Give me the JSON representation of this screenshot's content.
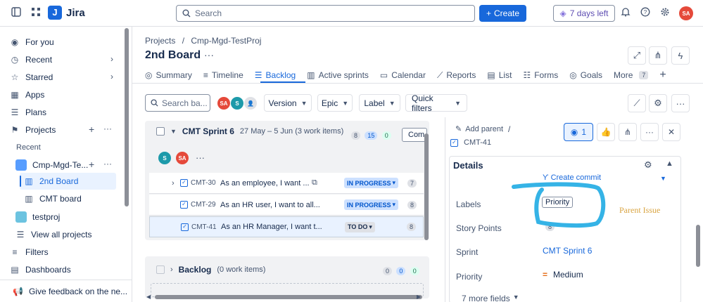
{
  "topbar": {
    "app_name": "Jira",
    "search_placeholder": "Search",
    "create_label": "Create",
    "trial_label": "7 days left",
    "user_initials": "SA"
  },
  "sidebar": {
    "items": [
      {
        "label": "For you",
        "icon": "user-circle-icon"
      },
      {
        "label": "Recent",
        "icon": "clock-icon"
      },
      {
        "label": "Starred",
        "icon": "star-icon"
      },
      {
        "label": "Apps",
        "icon": "apps-icon"
      },
      {
        "label": "Plans",
        "icon": "plans-icon"
      },
      {
        "label": "Projects",
        "icon": "projects-icon"
      }
    ],
    "recent_heading": "Recent",
    "project_name": "Cmp-Mgd-Te...",
    "boards": [
      "2nd Board",
      "CMT board"
    ],
    "other_project": "testproj",
    "view_all": "View all projects",
    "filters": "Filters",
    "dashboards": "Dashboards",
    "feedback": "Give feedback on the ne..."
  },
  "header": {
    "breadcrumb_root": "Projects",
    "breadcrumb_sep": "/",
    "breadcrumb_project": "Cmp-Mgd-TestProj",
    "title": "2nd Board",
    "dots": "···"
  },
  "tabs": [
    {
      "label": "Summary",
      "icon": "globe-icon"
    },
    {
      "label": "Timeline",
      "icon": "timeline-icon"
    },
    {
      "label": "Backlog",
      "icon": "backlog-icon",
      "active": true
    },
    {
      "label": "Active sprints",
      "icon": "columns-icon"
    },
    {
      "label": "Calendar",
      "icon": "calendar-icon"
    },
    {
      "label": "Reports",
      "icon": "chart-icon"
    },
    {
      "label": "List",
      "icon": "list-icon"
    },
    {
      "label": "Forms",
      "icon": "forms-icon"
    },
    {
      "label": "Goals",
      "icon": "target-icon"
    }
  ],
  "more_tab": {
    "label": "More",
    "count": "7"
  },
  "filters": {
    "search_placeholder": "Search ba...",
    "avatars": [
      {
        "initials": "SA",
        "color": "#e5493a"
      },
      {
        "initials": "S",
        "color": "#1d9aaa"
      }
    ],
    "version": "Version",
    "epic": "Epic",
    "label": "Label",
    "quick_filters": "Quick filters"
  },
  "sprint": {
    "name": "CMT Sprint 6",
    "dates": "27 May – 5 Jun (3 work items)",
    "counts": [
      "8",
      "15",
      "0"
    ],
    "complete_label": "Com",
    "avatars": [
      "S",
      "SA"
    ],
    "rows": [
      {
        "key": "CMT-30",
        "summary": "As an employee, I want ...",
        "status": "IN PROGRESS",
        "points": "7"
      },
      {
        "key": "CMT-29",
        "summary": "As an HR user, I want to all...",
        "status": "IN PROGRESS",
        "points": "8"
      },
      {
        "key": "CMT-41",
        "summary": "As an HR Manager, I want t...",
        "status": "TO DO",
        "points": "8"
      }
    ]
  },
  "backlog": {
    "name": "Backlog",
    "count_text": "(0 work items)",
    "counts": [
      "0",
      "0",
      "0"
    ]
  },
  "detail": {
    "add_parent": "Add parent",
    "sep": "/",
    "issue_key": "CMT-41",
    "watch_count": "1",
    "details_heading": "Details",
    "create_commit": "Create commit",
    "fields": [
      {
        "label": "Labels",
        "value": "Priority"
      },
      {
        "label": "Story Points",
        "value": "8"
      },
      {
        "label": "Sprint",
        "value": "CMT Sprint 6"
      },
      {
        "label": "Priority",
        "value": "Medium"
      }
    ],
    "more_fields": "7 more fields",
    "annotation": "Parent Issue"
  }
}
